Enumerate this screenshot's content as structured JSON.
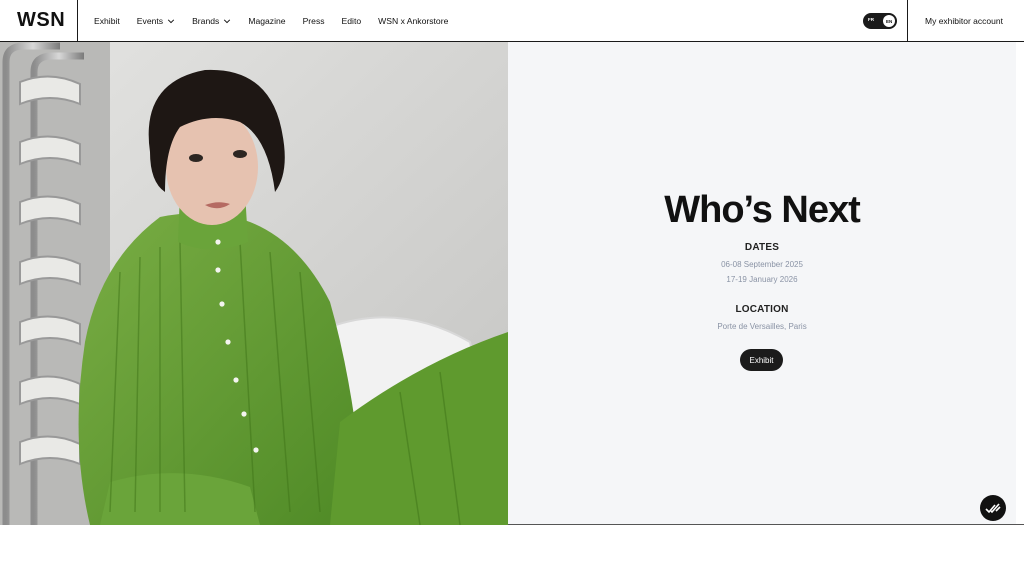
{
  "header": {
    "logo": "WSN",
    "nav": [
      {
        "label": "Exhibit",
        "dropdown": false
      },
      {
        "label": "Events",
        "dropdown": true
      },
      {
        "label": "Brands",
        "dropdown": true
      },
      {
        "label": "Magazine",
        "dropdown": false
      },
      {
        "label": "Press",
        "dropdown": false
      },
      {
        "label": "Edito",
        "dropdown": false
      },
      {
        "label": "WSN x Ankorstore",
        "dropdown": false
      }
    ],
    "language": {
      "option_fr": "FR",
      "option_en": "EN",
      "selected": "EN"
    },
    "account_label": "My exhibitor account"
  },
  "hero": {
    "image_icon": "fashion-photo",
    "title": "Who’s Next",
    "dates_label": "DATES",
    "dates": [
      "06-08 September 2025",
      "17-19 January 2026"
    ],
    "location_label": "LOCATION",
    "location": "Porte de Versailles, Paris",
    "cta_label": "Exhibit"
  },
  "floating_badge": {
    "icon": "checkmarks-icon"
  },
  "colors": {
    "accent": "#1b1b1b",
    "panel_bg": "#f5f6f8",
    "info_text": "#8a93a5",
    "sweater_green": "#6fa23c"
  }
}
